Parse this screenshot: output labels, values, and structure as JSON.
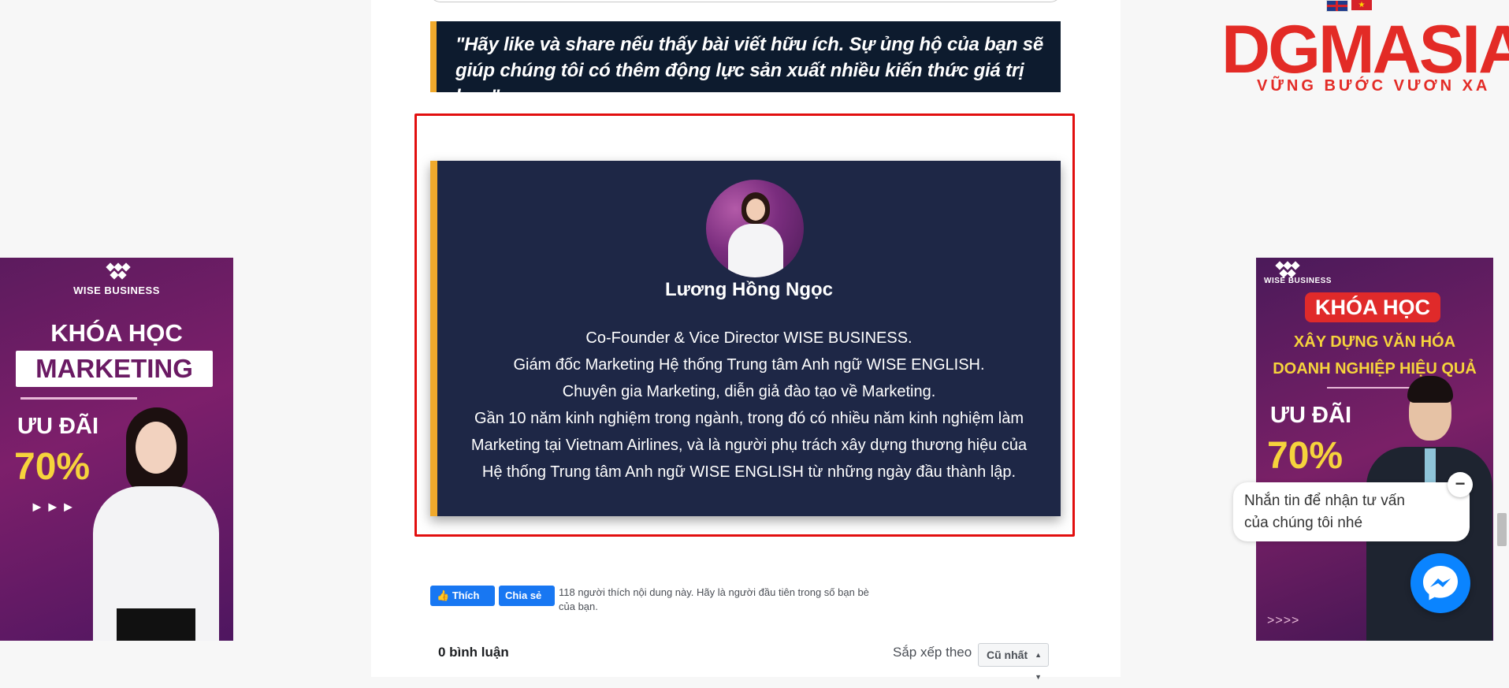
{
  "quote": {
    "line1": "\"Hãy like và share nếu thấy bài viết hữu ích. Sự ủng hộ của bạn sẽ",
    "line2": "giúp chúng tôi có thêm động lực sản xuất nhiều kiến thức giá trị hơn\""
  },
  "author": {
    "name": "Lương Hồng Ngọc",
    "bio_lines": [
      "Co-Founder & Vice Director WISE BUSINESS.",
      "Giám đốc Marketing Hệ thống Trung tâm Anh ngữ WISE ENGLISH.",
      "Chuyên gia Marketing, diễn giả đào tạo về Marketing.",
      "Gần 10 năm kinh nghiệm trong ngành, trong đó có nhiều năm kinh nghiệm làm",
      "Marketing tại Vietnam Airlines, và là người phụ trách xây dựng thương hiệu của",
      "Hệ thống Trung tâm Anh ngữ WISE ENGLISH từ những ngày đầu thành lập."
    ]
  },
  "facebook": {
    "like_label": "Thích",
    "share_label": "Chia sẻ",
    "like_text": "118 người thích nội dung này. Hãy là người đầu tiên trong số bạn bè của bạn."
  },
  "comments": {
    "count_label": "0 bình luận",
    "sort_label": "Sắp xếp theo",
    "sort_value": "Cũ nhất"
  },
  "ad_left": {
    "brand": "WISE BUSINESS",
    "course": "KHÓA HỌC",
    "topic": "MARKETING",
    "offer": "ƯU ĐÃI",
    "percent": "70%",
    "arrows": "►►►"
  },
  "ad_right": {
    "brand": "WISE BUSINESS",
    "course": "KHÓA HỌC",
    "topic_line1": "XÂY DỰNG VĂN HÓA",
    "topic_line2": "DOANH NGHIỆP HIỆU QUẢ",
    "offer": "ƯU ĐÃI",
    "percent": "70%",
    "arrows": ">>>>"
  },
  "logo": {
    "wordmark": "DGMASIA",
    "tagline": "VỮNG BƯỚC VƯƠN XA"
  },
  "chat": {
    "prompt_line1": "Nhắn tin để nhận tư vấn",
    "prompt_line2": "của chúng tôi nhé",
    "close_symbol": "−"
  },
  "colors": {
    "accent": "#f0a92c",
    "quote_bg": "#0d1b2e",
    "author_bg": "#1e2746",
    "highlight": "#e20f0f",
    "facebook": "#1877f2",
    "brand_red": "#e32b26",
    "messenger": "#0a84ff"
  }
}
